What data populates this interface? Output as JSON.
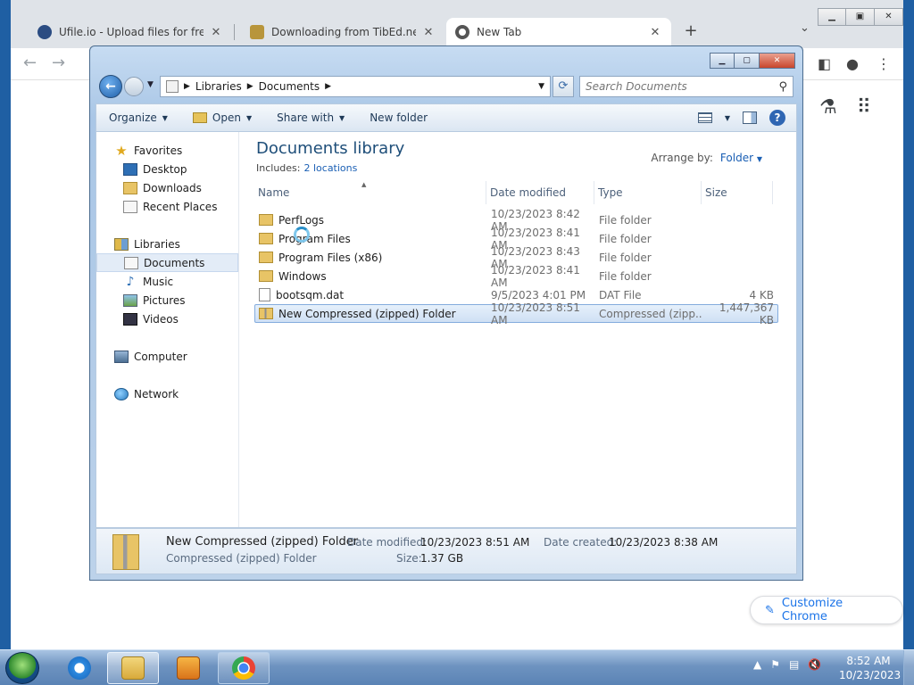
{
  "browser": {
    "tabs": [
      {
        "title": "Ufile.io - Upload files for free & s",
        "icon": "ufile-icon",
        "icon_color": "#2b4c82"
      },
      {
        "title": "Downloading from TibEd.net",
        "icon": "tibed-icon",
        "icon_color": "#b8953b"
      },
      {
        "title": "New Tab",
        "icon": "chrome-icon",
        "icon_color": "#555555"
      }
    ],
    "customize_label": "Customize Chrome"
  },
  "explorer": {
    "breadcrumb": [
      "Libraries",
      "Documents"
    ],
    "search_placeholder": "Search Documents",
    "commands": {
      "organize": "Organize",
      "open": "Open",
      "share_with": "Share with",
      "new_folder": "New folder"
    },
    "nav": {
      "favorites": "Favorites",
      "desktop": "Desktop",
      "downloads": "Downloads",
      "recent_places": "Recent Places",
      "libraries": "Libraries",
      "documents": "Documents",
      "music": "Music",
      "pictures": "Pictures",
      "videos": "Videos",
      "computer": "Computer",
      "network": "Network"
    },
    "library": {
      "title": "Documents library",
      "includes_label": "Includes:",
      "includes_link": "2 locations",
      "arrange_label": "Arrange by:",
      "arrange_value": "Folder"
    },
    "columns": {
      "name": "Name",
      "date": "Date modified",
      "type": "Type",
      "size": "Size"
    },
    "files": [
      {
        "name": "PerfLogs",
        "date": "10/23/2023 8:42 AM",
        "type": "File folder",
        "size": ""
      },
      {
        "name": "Program Files",
        "date": "10/23/2023 8:41 AM",
        "type": "File folder",
        "size": ""
      },
      {
        "name": "Program Files (x86)",
        "date": "10/23/2023 8:43 AM",
        "type": "File folder",
        "size": ""
      },
      {
        "name": "Windows",
        "date": "10/23/2023 8:41 AM",
        "type": "File folder",
        "size": ""
      },
      {
        "name": "bootsqm.dat",
        "date": "9/5/2023 4:01 PM",
        "type": "DAT File",
        "size": "4 KB"
      },
      {
        "name": "New Compressed (zipped) Folder",
        "date": "10/23/2023 8:51 AM",
        "type": "Compressed (zipp...",
        "size": "1,447,367 KB"
      }
    ],
    "details": {
      "name": "New Compressed (zipped) Folder",
      "type": "Compressed (zipped) Folder",
      "date_modified_label": "Date modified:",
      "date_modified": "10/23/2023 8:51 AM",
      "date_created_label": "Date created:",
      "date_created": "10/23/2023 8:38 AM",
      "size_label": "Size:",
      "size": "1.37 GB"
    }
  },
  "taskbar": {
    "time": "8:52 AM",
    "date": "10/23/2023"
  }
}
